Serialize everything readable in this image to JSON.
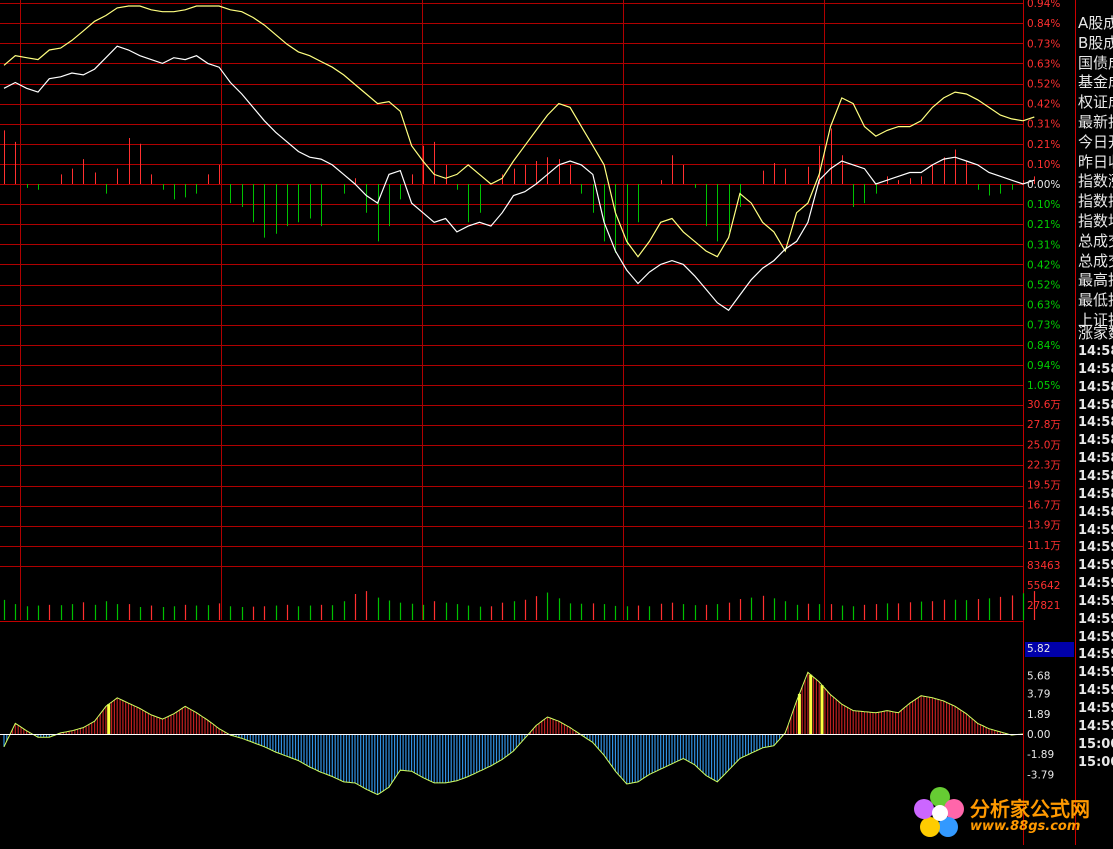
{
  "colors": {
    "grid": "#b00000",
    "up": "#ff3030",
    "down": "#00c000",
    "white_line": "#ffffff",
    "yellow_line": "#ffff80",
    "macd_red": "#c02020",
    "macd_blue": "#3090e0",
    "macd_yellow": "#ffff40",
    "macd_outline": "#d0ff60",
    "axis_text_up": "#ff3030",
    "axis_text_down": "#00d000",
    "axis_text_neutral": "#e8e8e8",
    "highlight_box": "#0000aa",
    "watermark": "#ff9900"
  },
  "price_axis": {
    "labels_up": [
      "0.94%",
      "0.84%",
      "0.73%",
      "0.63%",
      "0.52%",
      "0.42%",
      "0.31%",
      "0.21%",
      "0.10%"
    ],
    "label_zero": "0.00%",
    "labels_down": [
      "0.10%",
      "0.21%",
      "0.31%",
      "0.42%",
      "0.52%",
      "0.63%",
      "0.73%",
      "0.84%",
      "0.94%",
      "1.05%"
    ]
  },
  "volume_axis": {
    "labels": [
      "30.6万",
      "27.8万",
      "25.0万",
      "22.3万",
      "19.5万",
      "16.7万",
      "13.9万",
      "11.1万",
      "83463",
      "55642",
      "27821"
    ]
  },
  "macd_axis": {
    "highlight": "5.82",
    "labels": [
      "5.68",
      "3.79",
      "1.89",
      "0.00",
      "-1.89",
      "-3.79"
    ]
  },
  "side_panel": {
    "items": [
      "A股成",
      "B股成",
      "国债成",
      "基金成",
      "权证成",
      "最新指",
      "今日开",
      "昨日收",
      "指数涨",
      "指数振",
      "指数均",
      "总成交",
      "总成交",
      "最高指",
      "最低指",
      "上证指"
    ],
    "header": "涨家数",
    "times": [
      "14:58",
      "14:58",
      "14:58",
      "14:58",
      "14:58",
      "14:58",
      "14:58",
      "14:58",
      "14:58",
      "14:58",
      "14:59",
      "14:59",
      "14:59",
      "14:59",
      "14:59",
      "14:59",
      "14:59",
      "14:59",
      "14:59",
      "14:59",
      "14:59",
      "14:59",
      "15:00",
      "15:00"
    ]
  },
  "watermark": {
    "title": "分析家公式网",
    "url": "www.88gs.com"
  },
  "chart_data": [
    {
      "type": "line",
      "name_hint": "intraday price lines (percent change)",
      "ylim": [
        -1.05,
        0.94
      ],
      "series": [
        {
          "color": "yellow",
          "values": [
            0.62,
            0.67,
            0.66,
            0.65,
            0.7,
            0.71,
            0.75,
            0.8,
            0.85,
            0.88,
            0.92,
            0.93,
            0.93,
            0.91,
            0.9,
            0.9,
            0.91,
            0.93,
            0.93,
            0.93,
            0.91,
            0.9,
            0.87,
            0.83,
            0.78,
            0.73,
            0.69,
            0.67,
            0.64,
            0.61,
            0.57,
            0.52,
            0.47,
            0.42,
            0.43,
            0.38,
            0.2,
            0.12,
            0.05,
            0.03,
            0.05,
            0.1,
            0.05,
            0.0,
            0.03,
            0.12,
            0.2,
            0.28,
            0.36,
            0.42,
            0.4,
            0.3,
            0.2,
            0.1,
            -0.15,
            -0.3,
            -0.38,
            -0.3,
            -0.2,
            -0.18,
            -0.25,
            -0.3,
            -0.35,
            -0.38,
            -0.28,
            -0.05,
            -0.1,
            -0.2,
            -0.25,
            -0.35,
            -0.15,
            -0.1,
            0.05,
            0.3,
            0.45,
            0.42,
            0.3,
            0.25,
            0.28,
            0.3,
            0.3,
            0.33,
            0.4,
            0.45,
            0.48,
            0.47,
            0.44,
            0.4,
            0.36,
            0.34,
            0.33,
            0.35
          ]
        },
        {
          "color": "white",
          "values": [
            0.5,
            0.53,
            0.5,
            0.48,
            0.55,
            0.56,
            0.58,
            0.57,
            0.6,
            0.66,
            0.72,
            0.7,
            0.67,
            0.65,
            0.63,
            0.66,
            0.65,
            0.67,
            0.63,
            0.61,
            0.53,
            0.47,
            0.4,
            0.33,
            0.27,
            0.22,
            0.17,
            0.14,
            0.13,
            0.1,
            0.05,
            0.0,
            -0.06,
            -0.1,
            0.05,
            0.07,
            -0.1,
            -0.15,
            -0.2,
            -0.18,
            -0.25,
            -0.22,
            -0.2,
            -0.22,
            -0.15,
            -0.06,
            -0.04,
            0.0,
            0.05,
            0.1,
            0.12,
            0.1,
            0.05,
            -0.2,
            -0.35,
            -0.45,
            -0.52,
            -0.46,
            -0.42,
            -0.4,
            -0.42,
            -0.48,
            -0.55,
            -0.62,
            -0.66,
            -0.58,
            -0.5,
            -0.44,
            -0.4,
            -0.34,
            -0.3,
            -0.2,
            0.02,
            0.08,
            0.12,
            0.1,
            0.08,
            0.0,
            0.02,
            0.04,
            0.06,
            0.06,
            0.1,
            0.13,
            0.14,
            0.12,
            0.1,
            0.06,
            0.04,
            0.02,
            0.0,
            0.02
          ]
        }
      ]
    },
    {
      "type": "bar",
      "name_hint": "up/down breadth bars around zero line",
      "values": [
        0.28,
        0.22,
        -0.02,
        -0.03,
        0.0,
        0.05,
        0.08,
        0.13,
        0.06,
        -0.05,
        0.08,
        0.24,
        0.21,
        0.05,
        -0.03,
        -0.08,
        -0.07,
        -0.05,
        0.05,
        0.1,
        -0.1,
        -0.12,
        -0.2,
        -0.28,
        -0.26,
        -0.22,
        -0.2,
        -0.18,
        -0.22,
        0.0,
        -0.05,
        0.03,
        -0.15,
        -0.3,
        -0.22,
        -0.08,
        0.05,
        0.2,
        0.22,
        0.1,
        -0.03,
        -0.2,
        -0.15,
        0.0,
        0.05,
        0.08,
        0.1,
        0.12,
        0.14,
        0.13,
        0.1,
        -0.05,
        -0.15,
        -0.3,
        -0.36,
        -0.32,
        -0.2,
        0.0,
        0.02,
        0.15,
        0.1,
        -0.02,
        -0.22,
        -0.3,
        -0.25,
        -0.12,
        0.0,
        0.07,
        0.11,
        0.08,
        0.0,
        0.09,
        0.2,
        0.29,
        0.15,
        -0.12,
        -0.1,
        -0.05,
        0.04,
        0.02,
        0.03,
        0.04,
        0.1,
        0.14,
        0.18,
        0.12,
        -0.03,
        -0.06,
        -0.05,
        -0.03,
        0.02,
        0.04
      ]
    },
    {
      "type": "bar",
      "name_hint": "volume",
      "values": [
        27821,
        22000,
        19000,
        20000,
        21000,
        20500,
        22000,
        24500,
        21000,
        26000,
        22000,
        22000,
        18000,
        20000,
        18000,
        19000,
        21000,
        20000,
        20500,
        23000,
        19000,
        18000,
        18500,
        19000,
        20000,
        21000,
        19000,
        20000,
        21000,
        20500,
        26000,
        36000,
        40000,
        31000,
        27000,
        24000,
        22500,
        21000,
        26000,
        24000,
        22000,
        20000,
        18500,
        19000,
        24000,
        26000,
        28000,
        33000,
        38000,
        30000,
        23000,
        22500,
        23000,
        22000,
        19500,
        19000,
        20000,
        19000,
        22500,
        24000,
        22000,
        20500,
        21000,
        22000,
        24000,
        29000,
        31000,
        33500,
        30000,
        26000,
        21000,
        22500,
        22000,
        22000,
        20000,
        19000,
        21000,
        22000,
        23000,
        23000,
        24500,
        25500,
        26000,
        28000,
        28000,
        27500,
        29000,
        30000,
        32000,
        34000,
        37000,
        40000
      ]
    },
    {
      "type": "bar",
      "name_hint": "MACD-style histogram",
      "ylim": [
        -5.68,
        5.82
      ],
      "values": [
        -1.2,
        1.0,
        0.3,
        -0.3,
        -0.3,
        0.1,
        0.3,
        0.6,
        1.2,
        2.6,
        3.4,
        2.9,
        2.4,
        1.8,
        1.4,
        1.9,
        2.6,
        2.0,
        1.3,
        0.5,
        -0.1,
        -0.4,
        -0.8,
        -1.2,
        -1.7,
        -2.1,
        -2.5,
        -3.1,
        -3.6,
        -4.0,
        -4.5,
        -4.6,
        -5.2,
        -5.7,
        -5.0,
        -3.4,
        -3.5,
        -4.1,
        -4.6,
        -4.6,
        -4.4,
        -4.0,
        -3.5,
        -3.0,
        -2.4,
        -1.6,
        -0.4,
        0.8,
        1.6,
        1.2,
        0.6,
        -0.1,
        -0.8,
        -2.0,
        -3.5,
        -4.7,
        -4.5,
        -3.8,
        -3.3,
        -2.8,
        -2.3,
        -2.9,
        -3.9,
        -4.5,
        -3.4,
        -2.3,
        -1.8,
        -1.3,
        -1.1,
        0.1,
        3.1,
        5.8,
        4.9,
        3.7,
        2.8,
        2.2,
        2.1,
        2.0,
        2.2,
        2.0,
        2.9,
        3.6,
        3.4,
        3.1,
        2.6,
        1.9,
        1.0,
        0.5,
        0.2,
        -0.1,
        0.0
      ]
    }
  ]
}
